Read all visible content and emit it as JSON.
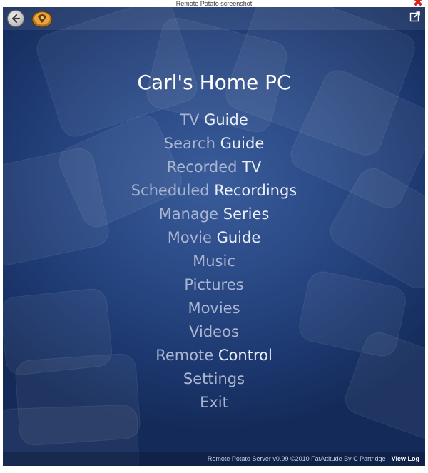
{
  "window": {
    "title": "Remote Potato screenshot",
    "close_glyph": "✖"
  },
  "topbar": {
    "back_icon": "back-arrow-icon",
    "logo_icon": "remote-potato-logo",
    "popout_icon": "external-window-icon"
  },
  "page": {
    "title": "Carl's Home PC"
  },
  "menu": {
    "items": [
      {
        "dim": "TV",
        "bright": " Guide"
      },
      {
        "dim": "Search",
        "bright": " Guide"
      },
      {
        "dim": "Recorded",
        "bright": " TV"
      },
      {
        "dim": "Scheduled",
        "bright": " Recordings"
      },
      {
        "dim": "Manage",
        "bright": " Series"
      },
      {
        "dim": "Movie",
        "bright": " Guide"
      },
      {
        "dim": "Music",
        "bright": ""
      },
      {
        "dim": "Pictures",
        "bright": ""
      },
      {
        "dim": "Movies",
        "bright": ""
      },
      {
        "dim": "Videos",
        "bright": ""
      },
      {
        "dim": "Remote",
        "bright": " Control"
      },
      {
        "dim": "Settings",
        "bright": ""
      },
      {
        "dim": "Exit",
        "bright": ""
      }
    ]
  },
  "footer": {
    "credits": "Remote Potato Server v0.99 ©2010 FatAttitude By C Partridge",
    "view_log": "View Log"
  },
  "colors": {
    "background": "#2a4a86",
    "title": "#ffffff",
    "menu_dim": "#aab5d0",
    "menu_bright": "#e9eef8",
    "close": "#d6261f"
  }
}
